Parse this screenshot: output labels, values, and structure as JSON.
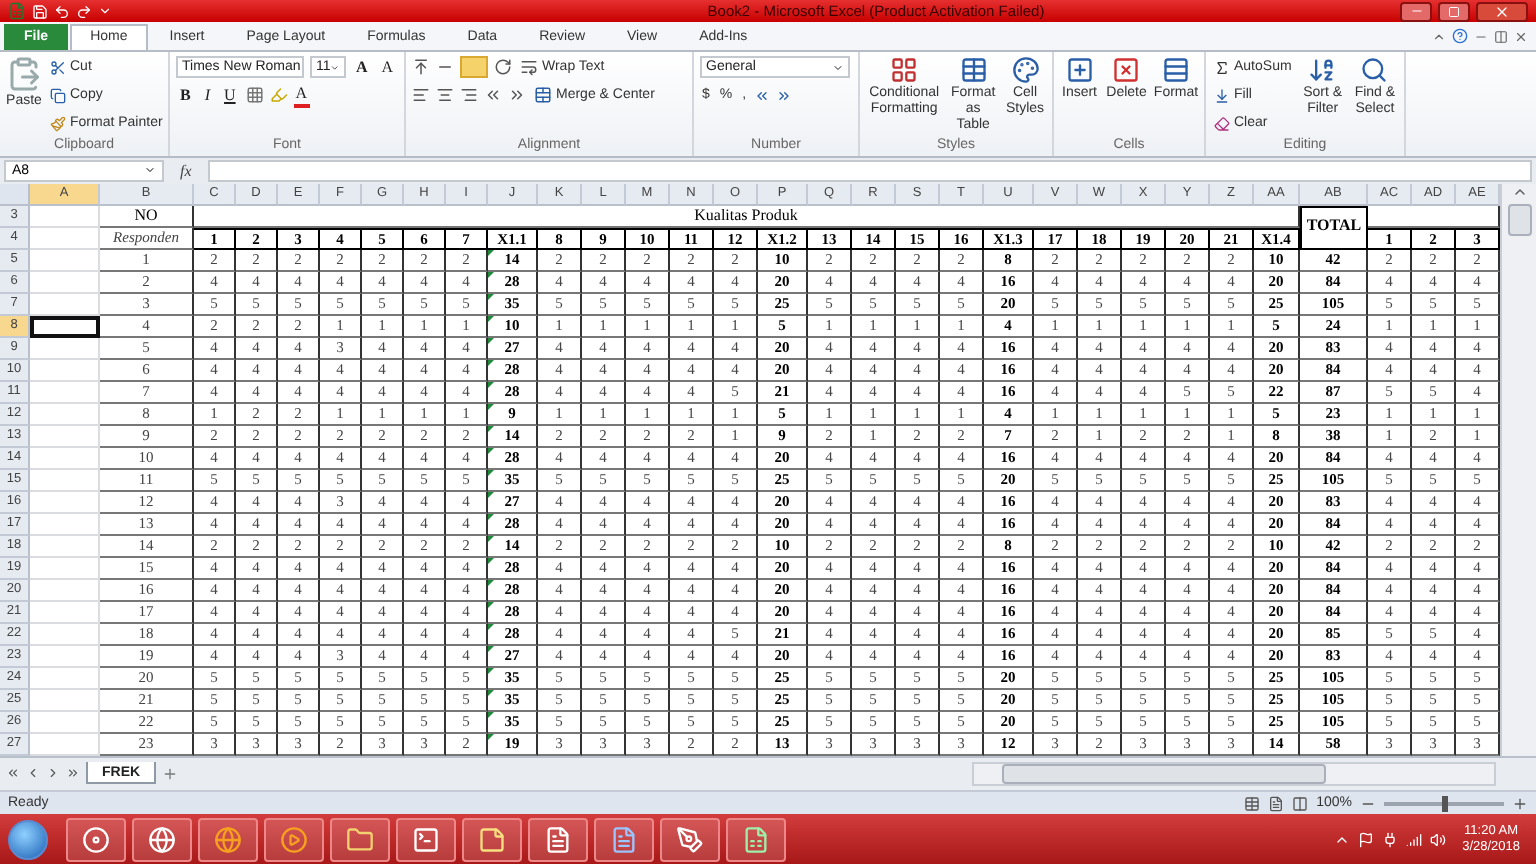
{
  "title_bar": {
    "title": "Book2 - Microsoft Excel (Product Activation Failed)"
  },
  "ribbon_tabs": [
    {
      "label": "File",
      "kind": "file",
      "selected": false
    },
    {
      "label": "Home",
      "kind": "tab",
      "selected": true
    },
    {
      "label": "Insert",
      "kind": "tab",
      "selected": false
    },
    {
      "label": "Page Layout",
      "kind": "tab",
      "selected": false
    },
    {
      "label": "Formulas",
      "kind": "tab",
      "selected": false
    },
    {
      "label": "Data",
      "kind": "tab",
      "selected": false
    },
    {
      "label": "Review",
      "kind": "tab",
      "selected": false
    },
    {
      "label": "View",
      "kind": "tab",
      "selected": false
    },
    {
      "label": "Add-Ins",
      "kind": "tab",
      "selected": false
    }
  ],
  "ribbon": {
    "clipboard": {
      "paste": "Paste",
      "cut": "Cut",
      "copy": "Copy",
      "format_painter": "Format Painter",
      "label": "Clipboard"
    },
    "font": {
      "font_name": "Times New Roman",
      "font_size": "11",
      "grow": "A",
      "shrink": "A",
      "bold": "B",
      "italic": "I",
      "underline": "U",
      "font_color": "A",
      "label": "Font"
    },
    "alignment": {
      "wrap_text": "Wrap Text",
      "merge_center": "Merge & Center",
      "label": "Alignment"
    },
    "number": {
      "format": "General",
      "currency": "$",
      "percent": "%",
      "comma": ",",
      "label": "Number"
    },
    "styles": {
      "conditional_formatting": "Conditional Formatting",
      "format_as_table": "Format as Table",
      "cell_styles": "Cell Styles",
      "label": "Styles"
    },
    "cells": {
      "insert": "Insert",
      "delete": "Delete",
      "format": "Format",
      "label": "Cells"
    },
    "editing": {
      "autosum": "AutoSum",
      "fill": "Fill",
      "clear": "Clear",
      "sort_filter": "Sort & Filter",
      "find_select": "Find & Select",
      "label": "Editing"
    }
  },
  "formula_bar": {
    "name_box": "A8",
    "function_label": "fx"
  },
  "column_headers": [
    {
      "label": "A",
      "selected": true
    },
    {
      "label": "B",
      "selected": false
    },
    {
      "label": "C",
      "selected": false
    },
    {
      "label": "D",
      "selected": false
    },
    {
      "label": "E",
      "selected": false
    },
    {
      "label": "F",
      "selected": false
    },
    {
      "label": "G",
      "selected": false
    },
    {
      "label": "H",
      "selected": false
    },
    {
      "label": "I",
      "selected": false
    },
    {
      "label": "J",
      "selected": false
    },
    {
      "label": "K",
      "selected": false
    },
    {
      "label": "L",
      "selected": false
    },
    {
      "label": "M",
      "selected": false
    },
    {
      "label": "N",
      "selected": false
    },
    {
      "label": "O",
      "selected": false
    },
    {
      "label": "P",
      "selected": false
    },
    {
      "label": "Q",
      "selected": false
    },
    {
      "label": "R",
      "selected": false
    },
    {
      "label": "S",
      "selected": false
    },
    {
      "label": "T",
      "selected": false
    },
    {
      "label": "U",
      "selected": false
    },
    {
      "label": "V",
      "selected": false
    },
    {
      "label": "W",
      "selected": false
    },
    {
      "label": "X",
      "selected": false
    },
    {
      "label": "Y",
      "selected": false
    },
    {
      "label": "Z",
      "selected": false
    },
    {
      "label": "AA",
      "selected": false
    },
    {
      "label": "AB",
      "selected": false
    },
    {
      "label": "AC",
      "selected": false
    },
    {
      "label": "AD",
      "selected": false
    },
    {
      "label": "AE",
      "selected": false
    }
  ],
  "sheet": {
    "header_row_3": {
      "row": "3",
      "no_label": "NO",
      "group_title": "Kualitas Produk",
      "total_label": "TOTAL"
    },
    "header_row_4": {
      "row": "4",
      "responden_label": "Responden",
      "items": [
        {
          "label": "1",
          "kind": "item"
        },
        {
          "label": "2",
          "kind": "item"
        },
        {
          "label": "3",
          "kind": "item"
        },
        {
          "label": "4",
          "kind": "item"
        },
        {
          "label": "5",
          "kind": "item"
        },
        {
          "label": "6",
          "kind": "item"
        },
        {
          "label": "7",
          "kind": "item"
        },
        {
          "label": "X1.1",
          "kind": "subtotal"
        },
        {
          "label": "8",
          "kind": "item"
        },
        {
          "label": "9",
          "kind": "item"
        },
        {
          "label": "10",
          "kind": "item"
        },
        {
          "label": "11",
          "kind": "item"
        },
        {
          "label": "12",
          "kind": "item"
        },
        {
          "label": "X1.2",
          "kind": "subtotal"
        },
        {
          "label": "13",
          "kind": "item"
        },
        {
          "label": "14",
          "kind": "item"
        },
        {
          "label": "15",
          "kind": "item"
        },
        {
          "label": "16",
          "kind": "item"
        },
        {
          "label": "X1.3",
          "kind": "subtotal"
        },
        {
          "label": "17",
          "kind": "item"
        },
        {
          "label": "18",
          "kind": "item"
        },
        {
          "label": "19",
          "kind": "item"
        },
        {
          "label": "20",
          "kind": "item"
        },
        {
          "label": "21",
          "kind": "item"
        },
        {
          "label": "X1.4",
          "kind": "subtotal"
        }
      ],
      "extra_items": [
        {
          "label": "1"
        },
        {
          "label": "2"
        },
        {
          "label": "3"
        }
      ]
    },
    "rows": [
      {
        "row": "5",
        "selected": false,
        "cells": [
          "1",
          "2",
          "2",
          "2",
          "2",
          "2",
          "2",
          "2",
          "14",
          "2",
          "2",
          "2",
          "2",
          "2",
          "10",
          "2",
          "2",
          "2",
          "2",
          "8",
          "2",
          "2",
          "2",
          "2",
          "2",
          "10",
          "42",
          "2",
          "2",
          "2"
        ]
      },
      {
        "row": "6",
        "selected": false,
        "cells": [
          "2",
          "4",
          "4",
          "4",
          "4",
          "4",
          "4",
          "4",
          "28",
          "4",
          "4",
          "4",
          "4",
          "4",
          "20",
          "4",
          "4",
          "4",
          "4",
          "16",
          "4",
          "4",
          "4",
          "4",
          "4",
          "20",
          "84",
          "4",
          "4",
          "4"
        ]
      },
      {
        "row": "7",
        "selected": false,
        "cells": [
          "3",
          "5",
          "5",
          "5",
          "5",
          "5",
          "5",
          "5",
          "35",
          "5",
          "5",
          "5",
          "5",
          "5",
          "25",
          "5",
          "5",
          "5",
          "5",
          "20",
          "5",
          "5",
          "5",
          "5",
          "5",
          "25",
          "105",
          "5",
          "5",
          "5"
        ]
      },
      {
        "row": "8",
        "selected": true,
        "cells": [
          "4",
          "2",
          "2",
          "2",
          "1",
          "1",
          "1",
          "1",
          "10",
          "1",
          "1",
          "1",
          "1",
          "1",
          "5",
          "1",
          "1",
          "1",
          "1",
          "4",
          "1",
          "1",
          "1",
          "1",
          "1",
          "5",
          "24",
          "1",
          "1",
          "1"
        ]
      },
      {
        "row": "9",
        "selected": false,
        "cells": [
          "5",
          "4",
          "4",
          "4",
          "3",
          "4",
          "4",
          "4",
          "27",
          "4",
          "4",
          "4",
          "4",
          "4",
          "20",
          "4",
          "4",
          "4",
          "4",
          "16",
          "4",
          "4",
          "4",
          "4",
          "4",
          "20",
          "83",
          "4",
          "4",
          "4"
        ]
      },
      {
        "row": "10",
        "selected": false,
        "cells": [
          "6",
          "4",
          "4",
          "4",
          "4",
          "4",
          "4",
          "4",
          "28",
          "4",
          "4",
          "4",
          "4",
          "4",
          "20",
          "4",
          "4",
          "4",
          "4",
          "16",
          "4",
          "4",
          "4",
          "4",
          "4",
          "20",
          "84",
          "4",
          "4",
          "4"
        ]
      },
      {
        "row": "11",
        "selected": false,
        "cells": [
          "7",
          "4",
          "4",
          "4",
          "4",
          "4",
          "4",
          "4",
          "28",
          "4",
          "4",
          "4",
          "4",
          "5",
          "21",
          "4",
          "4",
          "4",
          "4",
          "16",
          "4",
          "4",
          "4",
          "5",
          "5",
          "22",
          "87",
          "5",
          "5",
          "4"
        ]
      },
      {
        "row": "12",
        "selected": false,
        "cells": [
          "8",
          "1",
          "2",
          "2",
          "1",
          "1",
          "1",
          "1",
          "9",
          "1",
          "1",
          "1",
          "1",
          "1",
          "5",
          "1",
          "1",
          "1",
          "1",
          "4",
          "1",
          "1",
          "1",
          "1",
          "1",
          "5",
          "23",
          "1",
          "1",
          "1"
        ]
      },
      {
        "row": "13",
        "selected": false,
        "cells": [
          "9",
          "2",
          "2",
          "2",
          "2",
          "2",
          "2",
          "2",
          "14",
          "2",
          "2",
          "2",
          "2",
          "1",
          "9",
          "2",
          "1",
          "2",
          "2",
          "7",
          "2",
          "1",
          "2",
          "2",
          "1",
          "8",
          "38",
          "1",
          "2",
          "1"
        ]
      },
      {
        "row": "14",
        "selected": false,
        "cells": [
          "10",
          "4",
          "4",
          "4",
          "4",
          "4",
          "4",
          "4",
          "28",
          "4",
          "4",
          "4",
          "4",
          "4",
          "20",
          "4",
          "4",
          "4",
          "4",
          "16",
          "4",
          "4",
          "4",
          "4",
          "4",
          "20",
          "84",
          "4",
          "4",
          "4"
        ]
      },
      {
        "row": "15",
        "selected": false,
        "cells": [
          "11",
          "5",
          "5",
          "5",
          "5",
          "5",
          "5",
          "5",
          "35",
          "5",
          "5",
          "5",
          "5",
          "5",
          "25",
          "5",
          "5",
          "5",
          "5",
          "20",
          "5",
          "5",
          "5",
          "5",
          "5",
          "25",
          "105",
          "5",
          "5",
          "5"
        ]
      },
      {
        "row": "16",
        "selected": false,
        "cells": [
          "12",
          "4",
          "4",
          "4",
          "3",
          "4",
          "4",
          "4",
          "27",
          "4",
          "4",
          "4",
          "4",
          "4",
          "20",
          "4",
          "4",
          "4",
          "4",
          "16",
          "4",
          "4",
          "4",
          "4",
          "4",
          "20",
          "83",
          "4",
          "4",
          "4"
        ]
      },
      {
        "row": "17",
        "selected": false,
        "cells": [
          "13",
          "4",
          "4",
          "4",
          "4",
          "4",
          "4",
          "4",
          "28",
          "4",
          "4",
          "4",
          "4",
          "4",
          "20",
          "4",
          "4",
          "4",
          "4",
          "16",
          "4",
          "4",
          "4",
          "4",
          "4",
          "20",
          "84",
          "4",
          "4",
          "4"
        ]
      },
      {
        "row": "18",
        "selected": false,
        "cells": [
          "14",
          "2",
          "2",
          "2",
          "2",
          "2",
          "2",
          "2",
          "14",
          "2",
          "2",
          "2",
          "2",
          "2",
          "10",
          "2",
          "2",
          "2",
          "2",
          "8",
          "2",
          "2",
          "2",
          "2",
          "2",
          "10",
          "42",
          "2",
          "2",
          "2"
        ]
      },
      {
        "row": "19",
        "selected": false,
        "cells": [
          "15",
          "4",
          "4",
          "4",
          "4",
          "4",
          "4",
          "4",
          "28",
          "4",
          "4",
          "4",
          "4",
          "4",
          "20",
          "4",
          "4",
          "4",
          "4",
          "16",
          "4",
          "4",
          "4",
          "4",
          "4",
          "20",
          "84",
          "4",
          "4",
          "4"
        ]
      },
      {
        "row": "20",
        "selected": false,
        "cells": [
          "16",
          "4",
          "4",
          "4",
          "4",
          "4",
          "4",
          "4",
          "28",
          "4",
          "4",
          "4",
          "4",
          "4",
          "20",
          "4",
          "4",
          "4",
          "4",
          "16",
          "4",
          "4",
          "4",
          "4",
          "4",
          "20",
          "84",
          "4",
          "4",
          "4"
        ]
      },
      {
        "row": "21",
        "selected": false,
        "cells": [
          "17",
          "4",
          "4",
          "4",
          "4",
          "4",
          "4",
          "4",
          "28",
          "4",
          "4",
          "4",
          "4",
          "4",
          "20",
          "4",
          "4",
          "4",
          "4",
          "16",
          "4",
          "4",
          "4",
          "4",
          "4",
          "20",
          "84",
          "4",
          "4",
          "4"
        ]
      },
      {
        "row": "22",
        "selected": false,
        "cells": [
          "18",
          "4",
          "4",
          "4",
          "4",
          "4",
          "4",
          "4",
          "28",
          "4",
          "4",
          "4",
          "4",
          "5",
          "21",
          "4",
          "4",
          "4",
          "4",
          "16",
          "4",
          "4",
          "4",
          "4",
          "4",
          "20",
          "85",
          "5",
          "5",
          "4"
        ]
      },
      {
        "row": "23",
        "selected": false,
        "cells": [
          "19",
          "4",
          "4",
          "4",
          "3",
          "4",
          "4",
          "4",
          "27",
          "4",
          "4",
          "4",
          "4",
          "4",
          "20",
          "4",
          "4",
          "4",
          "4",
          "16",
          "4",
          "4",
          "4",
          "4",
          "4",
          "20",
          "83",
          "4",
          "4",
          "4"
        ]
      },
      {
        "row": "24",
        "selected": false,
        "cells": [
          "20",
          "5",
          "5",
          "5",
          "5",
          "5",
          "5",
          "5",
          "35",
          "5",
          "5",
          "5",
          "5",
          "5",
          "25",
          "5",
          "5",
          "5",
          "5",
          "20",
          "5",
          "5",
          "5",
          "5",
          "5",
          "25",
          "105",
          "5",
          "5",
          "5"
        ]
      },
      {
        "row": "25",
        "selected": false,
        "cells": [
          "21",
          "5",
          "5",
          "5",
          "5",
          "5",
          "5",
          "5",
          "35",
          "5",
          "5",
          "5",
          "5",
          "5",
          "25",
          "5",
          "5",
          "5",
          "5",
          "20",
          "5",
          "5",
          "5",
          "5",
          "5",
          "25",
          "105",
          "5",
          "5",
          "5"
        ]
      },
      {
        "row": "26",
        "selected": false,
        "cells": [
          "22",
          "5",
          "5",
          "5",
          "5",
          "5",
          "5",
          "5",
          "35",
          "5",
          "5",
          "5",
          "5",
          "5",
          "25",
          "5",
          "5",
          "5",
          "5",
          "20",
          "5",
          "5",
          "5",
          "5",
          "5",
          "25",
          "105",
          "5",
          "5",
          "5"
        ]
      },
      {
        "row": "27",
        "selected": false,
        "cells": [
          "23",
          "3",
          "3",
          "3",
          "2",
          "3",
          "3",
          "2",
          "19",
          "3",
          "3",
          "3",
          "2",
          "2",
          "13",
          "3",
          "3",
          "3",
          "3",
          "12",
          "3",
          "2",
          "3",
          "3",
          "3",
          "14",
          "58",
          "3",
          "3",
          "3"
        ]
      }
    ]
  },
  "sheet_tabs": [
    {
      "label": "FREK",
      "selected": true
    }
  ],
  "status_bar": {
    "status": "Ready",
    "zoom": "100%",
    "level": 0.5
  },
  "taskbar": {
    "time": "11:20 AM",
    "date": "3/28/2018"
  }
}
